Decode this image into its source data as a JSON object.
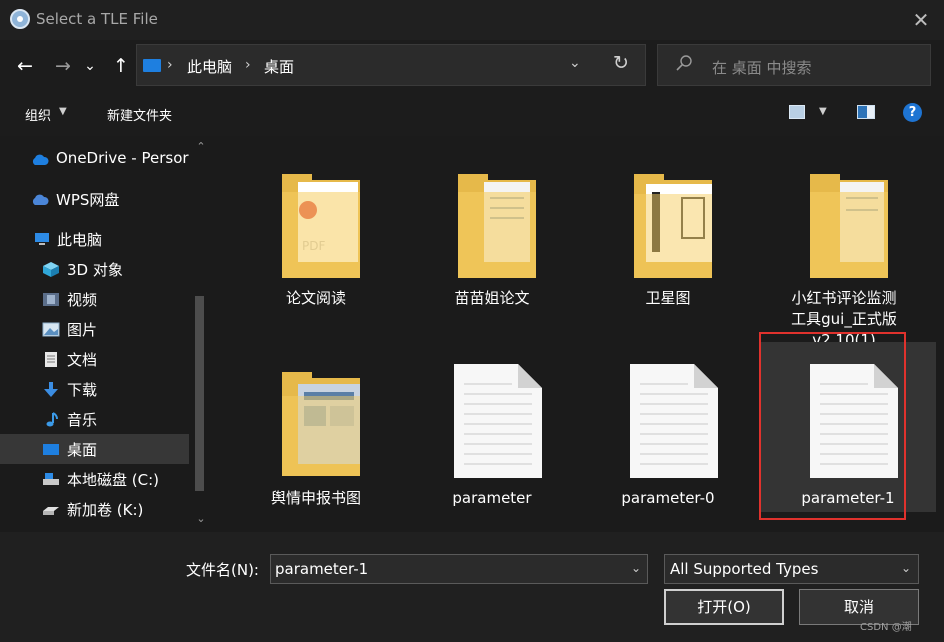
{
  "window": {
    "title": "Select a TLE File",
    "close_glyph": "✕"
  },
  "nav": {
    "back": "←",
    "forward": "→",
    "recent": "⌄",
    "up": "↑",
    "breadcrumb": [
      "此电脑",
      "桌面"
    ],
    "separator": "›",
    "search_placeholder": "在 桌面 中搜索"
  },
  "toolbar": {
    "organize": "组织",
    "new_folder": "新建文件夹",
    "help": "?"
  },
  "sidebar": {
    "items": [
      {
        "label": "OneDrive - Persor",
        "icon": "cloud-icon"
      },
      {
        "label": "WPS网盘",
        "icon": "cloud-icon"
      },
      {
        "label": "此电脑",
        "icon": "computer-icon"
      },
      {
        "label": "3D 对象",
        "icon": "cube-icon"
      },
      {
        "label": "视频",
        "icon": "video-icon"
      },
      {
        "label": "图片",
        "icon": "image-icon"
      },
      {
        "label": "文档",
        "icon": "document-icon"
      },
      {
        "label": "下载",
        "icon": "download-icon"
      },
      {
        "label": "音乐",
        "icon": "music-icon"
      },
      {
        "label": "桌面",
        "icon": "desktop-icon",
        "selected": true
      },
      {
        "label": "本地磁盘 (C:)",
        "icon": "drive-icon"
      },
      {
        "label": "新加卷 (K:)",
        "icon": "drive-icon"
      }
    ]
  },
  "files": [
    {
      "name": "论文阅读",
      "type": "folder"
    },
    {
      "name": "苗苗姐论文",
      "type": "folder"
    },
    {
      "name": "卫星图",
      "type": "folder"
    },
    {
      "name": "小红书评论监测工具gui_正式版v2.10(1)",
      "name_lines": [
        "小红书评论监测",
        "工具gui_正式版",
        "v2.10(1)"
      ],
      "type": "folder"
    },
    {
      "name": "舆情申报书图",
      "type": "folder"
    },
    {
      "name": "parameter",
      "type": "file"
    },
    {
      "name": "parameter-0",
      "type": "file"
    },
    {
      "name": "parameter-1",
      "type": "file",
      "selected": true
    }
  ],
  "bottom": {
    "filename_label": "文件名(N):",
    "filename_value": "parameter-1",
    "filetype_value": "All Supported Types",
    "open_label": "打开(O)",
    "cancel_label": "取消"
  },
  "watermark": "CSDN @潮"
}
